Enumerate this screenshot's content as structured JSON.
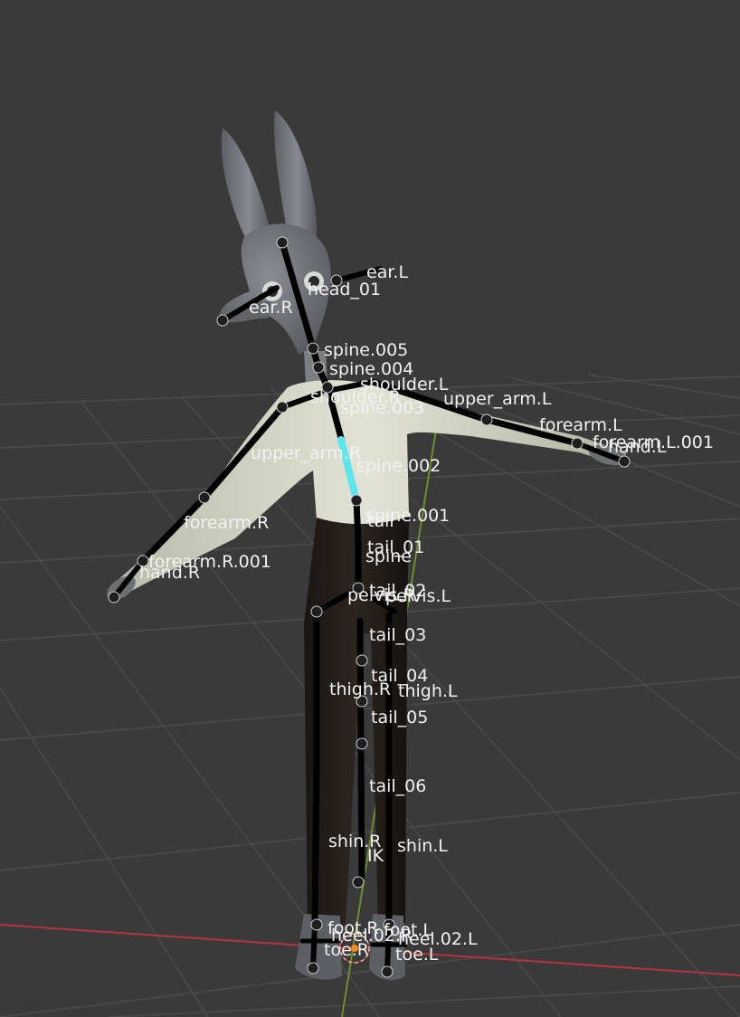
{
  "viewport": {
    "background_color": "#3a3a3a",
    "grid_color": "#4a4a4a",
    "x_axis_color": "#b5343e",
    "y_axis_color": "#6d8f2c",
    "active_bone_color": "#5ee6ee",
    "bone_color": "#000000"
  },
  "bone_labels": {
    "ear_L": "ear.L",
    "head_01": "head_01",
    "ear_R": "ear.R",
    "spine_005": "spine.005",
    "spine_004": "spine.004",
    "shoulder_L": "shoulder.L",
    "shoulder_R": "shoulder.R",
    "upper_arm_L": "upper_arm.L",
    "spine_003": "spine.003",
    "forearm_L": "forearm.L",
    "forearm_L_001": "forearm.L.001",
    "hand_L": "hand.L",
    "upper_arm_R": "upper_arm.R",
    "spine_002": "spine.002",
    "forearm_R": "forearm.R",
    "spine_001": "spine.001",
    "tail": "tail",
    "tail_01": "tail_01",
    "spine": "spine",
    "forearm_R_001": "forearm.R.001",
    "hand_R": "hand.R",
    "tail_02": "tail_02",
    "pelvis_R": "pelvis.R",
    "pelvis_L": "pelvis.L",
    "tail_03": "tail_03",
    "tail_04": "tail_04",
    "thigh_R": "thigh.R",
    "thigh_L": "thigh.L",
    "tail_05": "tail_05",
    "tail_06": "tail_06",
    "shin_R": "shin.R",
    "IK": "IK",
    "shin_L": "shin.L",
    "foot_R": "foot.R",
    "foot_L": "foot.L",
    "heel_02_R": "heel.02.R",
    "heel_02_L": "heel.02.L",
    "toe_R": "toe.R",
    "toe_L": "toe.L"
  }
}
